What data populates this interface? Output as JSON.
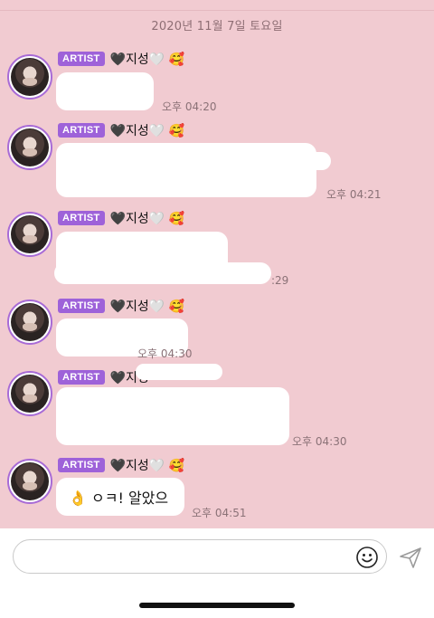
{
  "date_label": "2020년 11월 7일 토요일",
  "colors": {
    "background": "#f1cbd1",
    "badge": "#9e62d9",
    "bubble": "#ffffff"
  },
  "messages": [
    {
      "badge": "ARTIST",
      "name": "🖤지성🤍 🥰",
      "text": "",
      "time": "오후 04:20"
    },
    {
      "badge": "ARTIST",
      "name": "🖤지성🤍 🥰",
      "text": "",
      "time": "오후 04:21"
    },
    {
      "badge": "ARTIST",
      "name": "🖤지성🤍 🥰",
      "text": "",
      "time": ":29"
    },
    {
      "badge": "ARTIST",
      "name": "🖤지성🤍 🥰",
      "text": "",
      "time": "오후 04:30"
    },
    {
      "badge": "ARTIST",
      "name": "🖤지성",
      "text": "",
      "time": "오후 04:30"
    },
    {
      "badge": "ARTIST",
      "name": "🖤지성🤍 🥰",
      "text": "👌 ㅇㅋ! 알았으",
      "time": "오후 04:51"
    }
  ],
  "input": {
    "placeholder": "",
    "smile_icon": "smile-icon",
    "send_icon": "send-icon"
  }
}
